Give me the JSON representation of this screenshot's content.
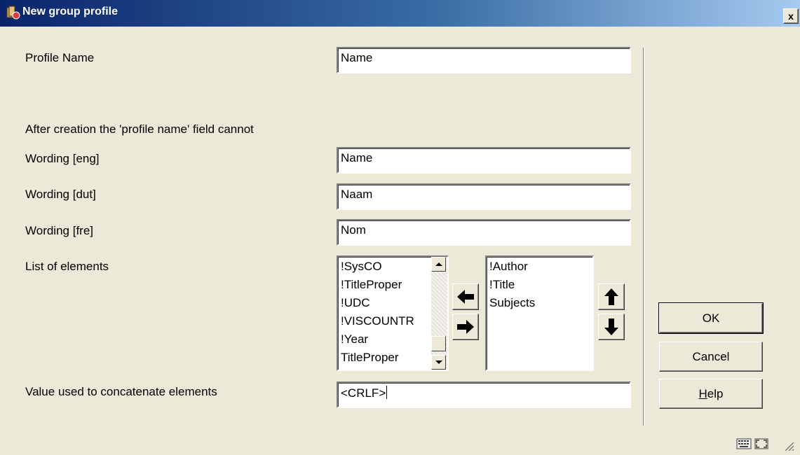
{
  "window": {
    "title": "New group profile",
    "close_label": "x"
  },
  "form": {
    "profile_name": {
      "label": "Profile Name",
      "value": "Name"
    },
    "note": "After creation the 'profile name' field cannot",
    "wording_eng": {
      "label": "Wording [eng]",
      "value": "Name"
    },
    "wording_dut": {
      "label": "Wording [dut]",
      "value": "Naam"
    },
    "wording_fre": {
      "label": "Wording [fre]",
      "value": "Nom"
    },
    "elements_label": "List of elements",
    "available_elements": [
      "!SysCO",
      "!TitleProper",
      "!UDC",
      "!VISCOUNTR",
      "!Year",
      "TitleProper"
    ],
    "selected_elements": [
      "!Author",
      "!Title",
      "Subjects"
    ],
    "concat": {
      "label": "Value used to concatenate elements",
      "value": "<CRLF>"
    }
  },
  "buttons": {
    "ok": "OK",
    "cancel": "Cancel",
    "help_underlined": "H",
    "help_rest": "elp"
  },
  "icons": [
    "app-icon",
    "close-icon",
    "arrow-left-icon",
    "arrow-right-icon",
    "arrow-up-icon",
    "arrow-down-icon",
    "keyboard-icon",
    "maximize-icon",
    "resize-grip-icon"
  ]
}
